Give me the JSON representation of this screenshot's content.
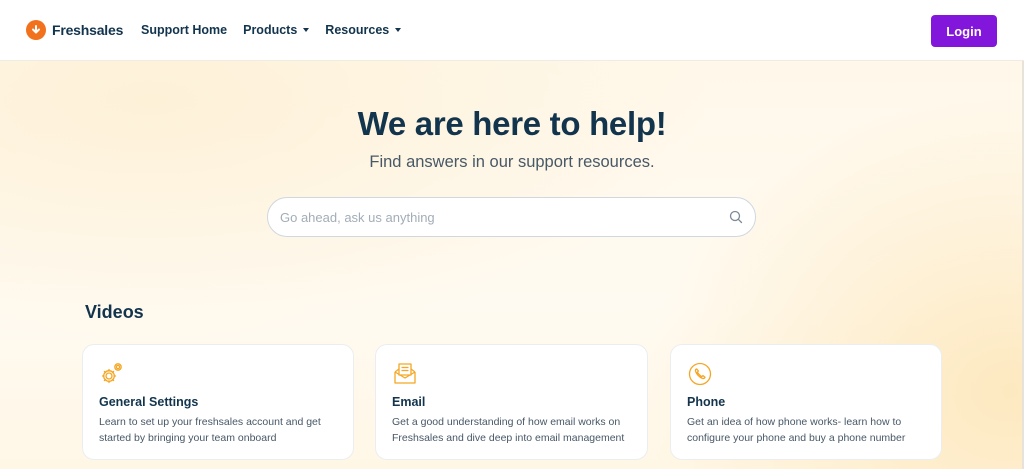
{
  "header": {
    "brand": "Freshsales",
    "nav": [
      {
        "label": "Support Home",
        "dropdown": false
      },
      {
        "label": "Products",
        "dropdown": true
      },
      {
        "label": "Resources",
        "dropdown": true
      }
    ],
    "login_label": "Login"
  },
  "hero": {
    "title": "We are here to help!",
    "subtitle": "Find answers in our support resources.",
    "search_placeholder": "Go ahead, ask us anything"
  },
  "videos": {
    "heading": "Videos",
    "cards": [
      {
        "icon": "gear-icon",
        "title": "General Settings",
        "description": "Learn to set up your freshsales account and get started by bringing your team onboard"
      },
      {
        "icon": "envelope-icon",
        "title": "Email",
        "description": "Get a good understanding of how email works on Freshsales and dive deep into email management"
      },
      {
        "icon": "phone-icon",
        "title": "Phone",
        "description": "Get an idea of how phone works- learn how to configure your phone and buy a phone number"
      }
    ]
  },
  "colors": {
    "brand_orange": "#f2711c",
    "login_purple": "#8217db",
    "heading_navy": "#12344d",
    "icon_amber": "#f5a623"
  }
}
